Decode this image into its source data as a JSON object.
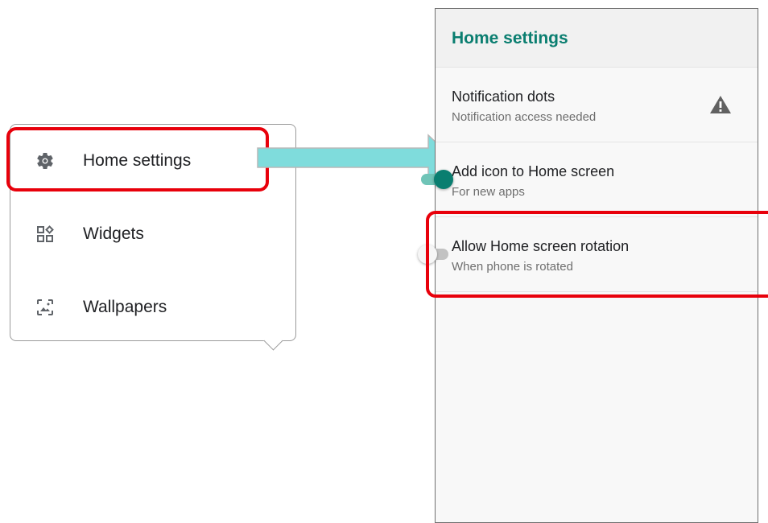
{
  "popup_menu": {
    "items": [
      {
        "label": "Home settings",
        "icon": "gear-icon"
      },
      {
        "label": "Widgets",
        "icon": "widgets-icon"
      },
      {
        "label": "Wallpapers",
        "icon": "wallpaper-icon"
      }
    ]
  },
  "settings_screen": {
    "title": "Home settings",
    "rows": [
      {
        "title": "Notification dots",
        "subtitle": "Notification access needed",
        "control": "warning-icon"
      },
      {
        "title": "Add icon to Home screen",
        "subtitle": "For new apps",
        "control": "toggle",
        "enabled": true
      },
      {
        "title": "Allow Home screen rotation",
        "subtitle": "When phone is rotated",
        "control": "toggle",
        "enabled": false
      }
    ]
  },
  "colors": {
    "accent": "#0a7e70",
    "highlight": "#e8000b",
    "arrow": "#7fdcdc"
  }
}
